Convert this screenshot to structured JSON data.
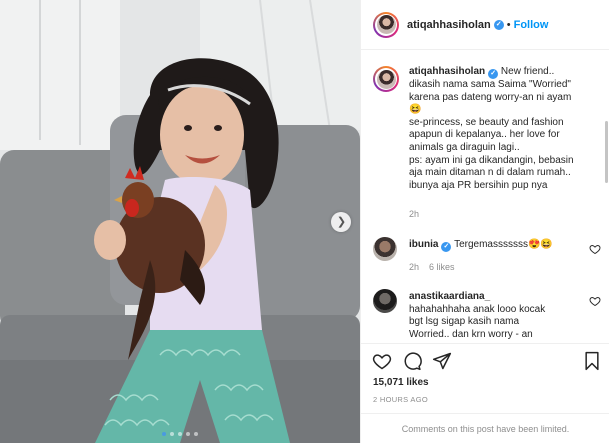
{
  "post": {
    "username": "atiqahhasiholan",
    "follow_label": "Follow",
    "separator": "•",
    "caption_lines": [
      "New friend..",
      "dikasih nama sama Saima \"Worried\"",
      "karena pas dateng worry-an ni ayam",
      "😆",
      "se-princess, se beauty and fashion",
      "apapun di kepalanya.. her love for",
      "animals ga diraguin lagi..",
      "ps: ayam ini ga dikandangin, bebasin",
      "aja main ditaman n di dalam rumah..",
      "ibunya aja PR bersihin pup nya"
    ],
    "caption_time": "2h",
    "carousel": {
      "slides": 5,
      "active_index": 0
    }
  },
  "comments": [
    {
      "username": "ibunia",
      "verified": true,
      "text": "Tergemasssssss😍😆",
      "time": "2h",
      "likes": "6 likes"
    },
    {
      "username": "anastikaardiana_",
      "verified": false,
      "lines": [
        "hahahahhaha anak looo kocak",
        "bgt lsg sigap kasih nama",
        "Worried.. dan krn worry - an"
      ]
    }
  ],
  "stats": {
    "likes": "15,071 likes",
    "posted": "2 HOURS AGO"
  },
  "footer": {
    "notice": "Comments on this post have been limited."
  },
  "icons": {
    "verified": "verified-badge-icon",
    "like": "heart-icon",
    "comment": "comment-bubble-icon",
    "share": "paper-plane-icon",
    "save": "bookmark-icon",
    "next": "chevron-right-icon"
  },
  "colors": {
    "accent": "#0095f6",
    "verified": "#3897f0",
    "text": "#262626",
    "muted": "#8e8e8e"
  }
}
